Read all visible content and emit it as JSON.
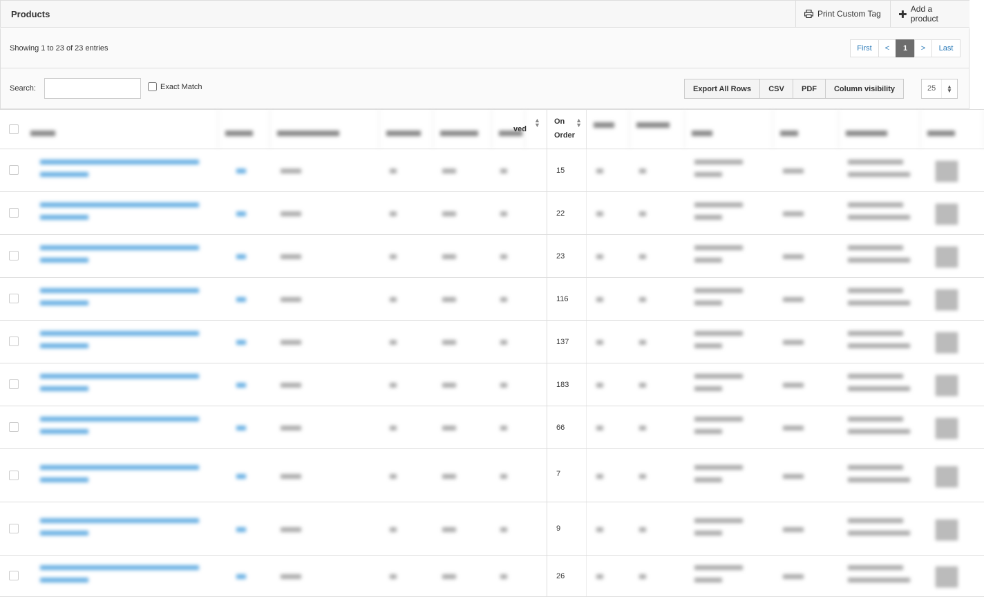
{
  "panel": {
    "title": "Products",
    "print_tag_label": "Print Custom Tag",
    "add_product_label": "Add a product"
  },
  "info": {
    "showing": "Showing 1 to 23 of 23 entries"
  },
  "pagination": {
    "first": "First",
    "prev": "<",
    "current": "1",
    "next": ">",
    "last": "Last"
  },
  "toolbar": {
    "search_label": "Search:",
    "search_value": "",
    "exact_match_label": "Exact Match",
    "export_all": "Export All Rows",
    "csv": "CSV",
    "pdf": "PDF",
    "column_visibility": "Column visibility",
    "page_length": "25"
  },
  "table": {
    "visible_header": "On Order",
    "visible_header_line1": "On",
    "visible_header_line2": "Order",
    "partial_header_fragment": "ved",
    "on_order_values": [
      "15",
      "22",
      "23",
      "116",
      "137",
      "183",
      "66",
      "7",
      "9",
      "26"
    ],
    "colors": {
      "link": "#2a8fd7",
      "active_page": "#6d6d6d"
    }
  }
}
